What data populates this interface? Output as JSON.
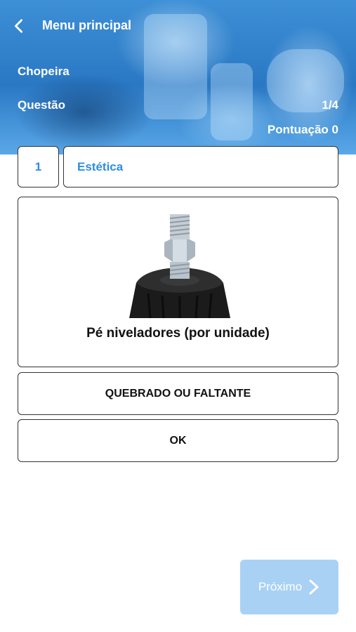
{
  "header": {
    "menu_title": "Menu principal",
    "section_name": "Chopeira",
    "question_label": "Questão",
    "question_count": "1/4",
    "score": "Pontuação 0"
  },
  "question": {
    "number": "1",
    "category": "Estética",
    "item_caption": "Pé niveladores (por unidade)"
  },
  "options": [
    {
      "label": "QUEBRADO OU FALTANTE"
    },
    {
      "label": "OK"
    }
  ],
  "next_button": {
    "label": "Próximo"
  },
  "icons": {
    "back": "chevron-left-icon",
    "next": "chevron-right-icon"
  },
  "colors": {
    "accent": "#2d8ee0",
    "next_disabled": "#a9d1f4",
    "header_blue": "#2a78c4"
  }
}
